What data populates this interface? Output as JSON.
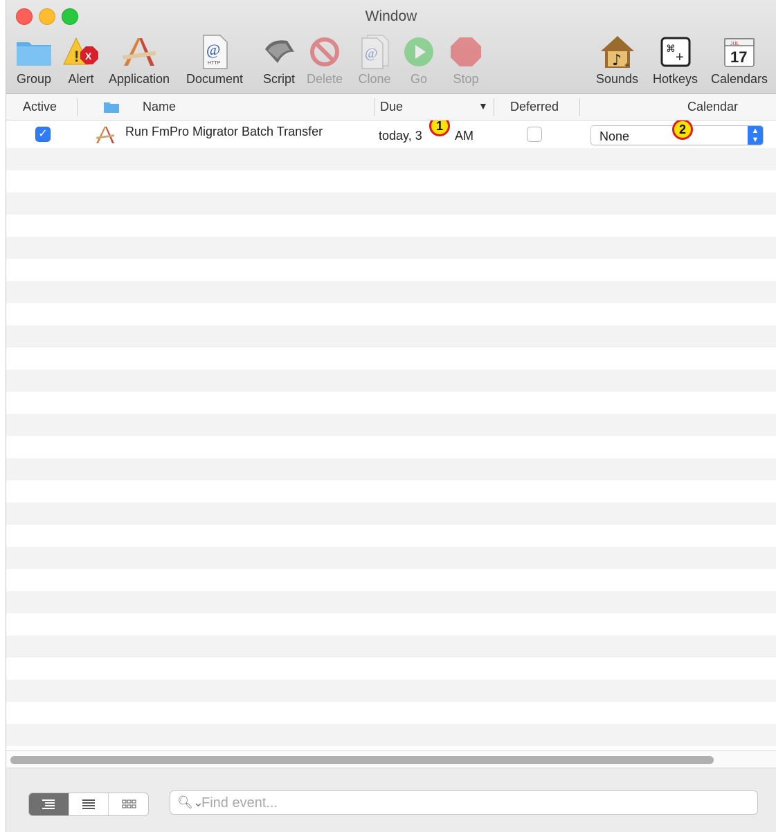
{
  "window": {
    "title": "Window"
  },
  "toolbar": {
    "items": [
      {
        "label": "Group",
        "icon": "folder-icon"
      },
      {
        "label": "Alert",
        "icon": "alert-icon"
      },
      {
        "label": "Application",
        "icon": "application-icon"
      },
      {
        "label": "Document",
        "icon": "document-icon"
      },
      {
        "label": "Script",
        "icon": "script-icon"
      },
      {
        "label": "Delete",
        "icon": "delete-icon",
        "disabled": true
      },
      {
        "label": "Clone",
        "icon": "clone-icon",
        "disabled": true
      },
      {
        "label": "Go",
        "icon": "play-icon",
        "disabled": true
      },
      {
        "label": "Stop",
        "icon": "stop-icon",
        "disabled": true
      },
      {
        "label": "Sounds",
        "icon": "sounds-icon"
      },
      {
        "label": "Hotkeys",
        "icon": "hotkeys-icon"
      },
      {
        "label": "Calendars",
        "icon": "calendar-icon"
      }
    ],
    "calendar_icon_month": "JUL",
    "calendar_icon_day": "17",
    "doc_icon_text": "HTTP"
  },
  "table": {
    "headers": {
      "active": "Active",
      "name": "Name",
      "due": "Due",
      "deferred": "Deferred",
      "calendar": "Calendar"
    },
    "rows": [
      {
        "active": true,
        "name": "Run FmPro Migrator Batch Transfer",
        "due": "today, 3",
        "due_suffix": "AM",
        "deferred": false,
        "calendar": "None"
      }
    ]
  },
  "annotations": {
    "badge1": "1",
    "badge2": "2"
  },
  "search": {
    "placeholder": "Find event..."
  },
  "colors": {
    "accent": "#2f7cf6",
    "stripe": "#f3f3f3",
    "badge_fill": "#fde200",
    "badge_border": "#e41a1a"
  }
}
